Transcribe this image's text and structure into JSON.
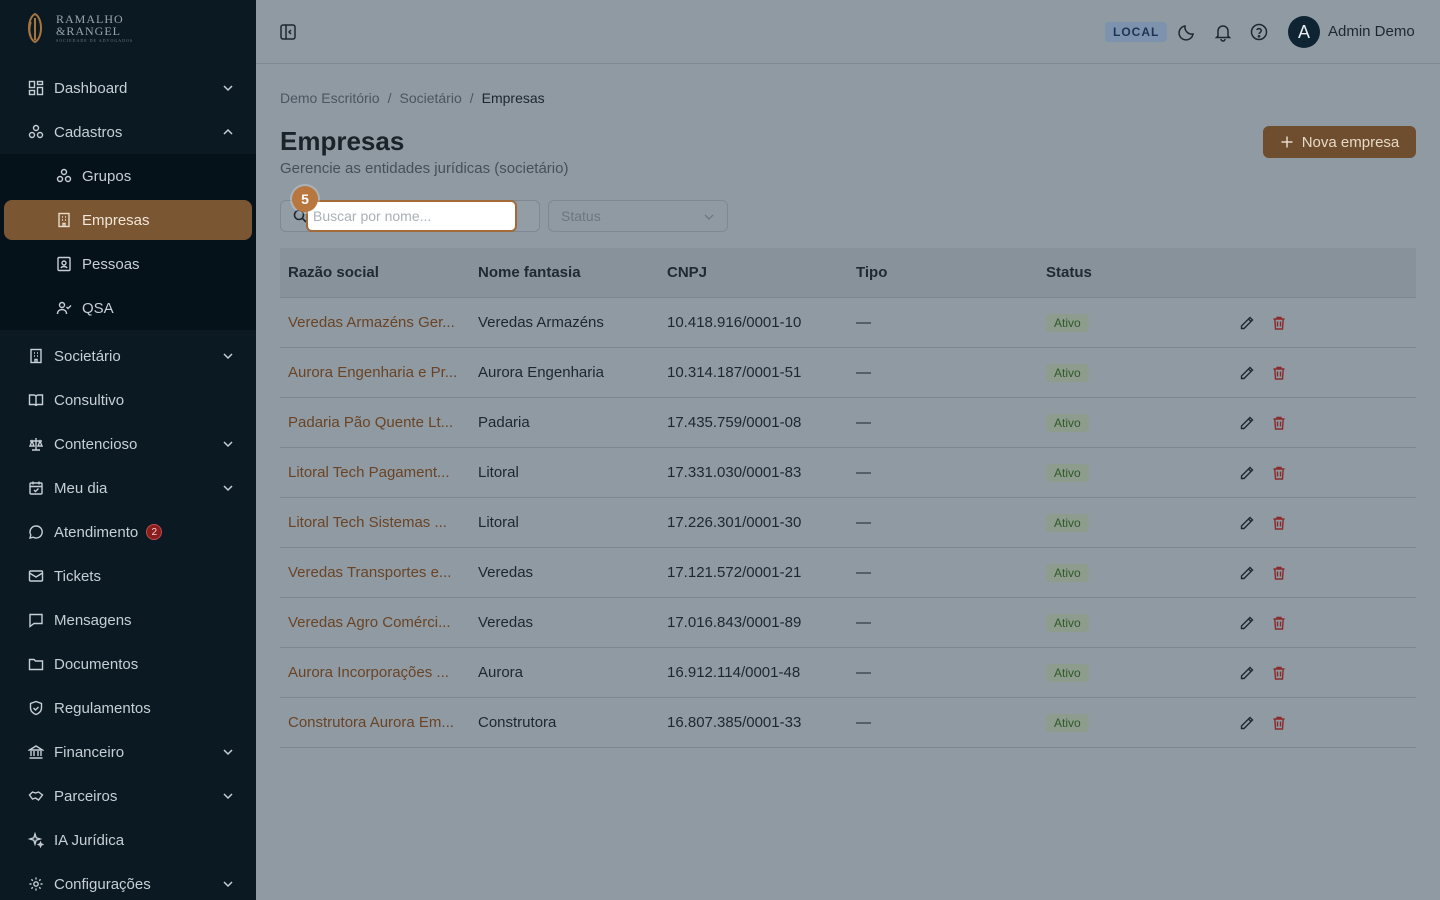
{
  "brand": {
    "line1": "RAMALHO",
    "line2": "&RANGEL",
    "line3": "SOCIEDADE DE ADVOGADOS"
  },
  "sidebar": {
    "items": [
      {
        "label": "Dashboard",
        "icon": "dashboard-icon",
        "chevron": "down"
      },
      {
        "label": "Cadastros",
        "icon": "cadastros-icon",
        "chevron": "up"
      },
      {
        "label": "Societário",
        "icon": "building-icon",
        "chevron": "down"
      },
      {
        "label": "Consultivo",
        "icon": "book-icon"
      },
      {
        "label": "Contencioso",
        "icon": "scale-icon",
        "chevron": "down"
      },
      {
        "label": "Meu dia",
        "icon": "calendar-icon",
        "chevron": "down"
      },
      {
        "label": "Atendimento",
        "icon": "chat-icon",
        "badge": "2"
      },
      {
        "label": "Tickets",
        "icon": "ticket-icon"
      },
      {
        "label": "Mensagens",
        "icon": "message-icon"
      },
      {
        "label": "Documentos",
        "icon": "folder-icon"
      },
      {
        "label": "Regulamentos",
        "icon": "shield-icon"
      },
      {
        "label": "Financeiro",
        "icon": "bank-icon",
        "chevron": "down"
      },
      {
        "label": "Parceiros",
        "icon": "handshake-icon",
        "chevron": "down"
      },
      {
        "label": "IA Jurídica",
        "icon": "sparkle-icon"
      },
      {
        "label": "Configurações",
        "icon": "gear-icon",
        "chevron": "down"
      }
    ],
    "sub_items": [
      {
        "label": "Grupos",
        "icon": "group-icon"
      },
      {
        "label": "Empresas",
        "icon": "company-icon",
        "active": true
      },
      {
        "label": "Pessoas",
        "icon": "person-card-icon"
      },
      {
        "label": "QSA",
        "icon": "user-check-icon"
      }
    ]
  },
  "topbar": {
    "env": "LOCAL",
    "avatar_initial": "A",
    "user_name": "Admin Demo"
  },
  "breadcrumb": [
    "Demo Escritório",
    "Societário",
    "Empresas"
  ],
  "page": {
    "title": "Empresas",
    "subtitle": "Gerencie as entidades jurídicas (societário)",
    "new_button": "Nova empresa"
  },
  "filters": {
    "search_placeholder": "Buscar por nome...",
    "status_placeholder": "Status",
    "step_marker": "5"
  },
  "table": {
    "headers": [
      "Razão social",
      "Nome fantasia",
      "CNPJ",
      "Tipo",
      "Status"
    ],
    "rows": [
      {
        "razao": "Veredas Armazéns Ger...",
        "fantasia": "Veredas Armazéns",
        "cnpj": "10.418.916/0001-10",
        "tipo": "—",
        "status": "Ativo"
      },
      {
        "razao": "Aurora Engenharia e Pr...",
        "fantasia": "Aurora Engenharia",
        "cnpj": "10.314.187/0001-51",
        "tipo": "—",
        "status": "Ativo"
      },
      {
        "razao": "Padaria Pão Quente Lt...",
        "fantasia": "Padaria",
        "cnpj": "17.435.759/0001-08",
        "tipo": "—",
        "status": "Ativo"
      },
      {
        "razao": "Litoral Tech Pagament...",
        "fantasia": "Litoral",
        "cnpj": "17.331.030/0001-83",
        "tipo": "—",
        "status": "Ativo"
      },
      {
        "razao": "Litoral Tech Sistemas ...",
        "fantasia": "Litoral",
        "cnpj": "17.226.301/0001-30",
        "tipo": "—",
        "status": "Ativo"
      },
      {
        "razao": "Veredas Transportes e...",
        "fantasia": "Veredas",
        "cnpj": "17.121.572/0001-21",
        "tipo": "—",
        "status": "Ativo"
      },
      {
        "razao": "Veredas Agro Comérci...",
        "fantasia": "Veredas",
        "cnpj": "17.016.843/0001-89",
        "tipo": "—",
        "status": "Ativo"
      },
      {
        "razao": "Aurora Incorporações ...",
        "fantasia": "Aurora",
        "cnpj": "16.912.114/0001-48",
        "tipo": "—",
        "status": "Ativo"
      },
      {
        "razao": "Construtora Aurora Em...",
        "fantasia": "Construtora",
        "cnpj": "16.807.385/0001-33",
        "tipo": "—",
        "status": "Ativo"
      }
    ]
  },
  "colors": {
    "sidebar_bg": "#0b1a22",
    "accent": "#7a5632",
    "overlay_bg": "#8f9aa3"
  }
}
